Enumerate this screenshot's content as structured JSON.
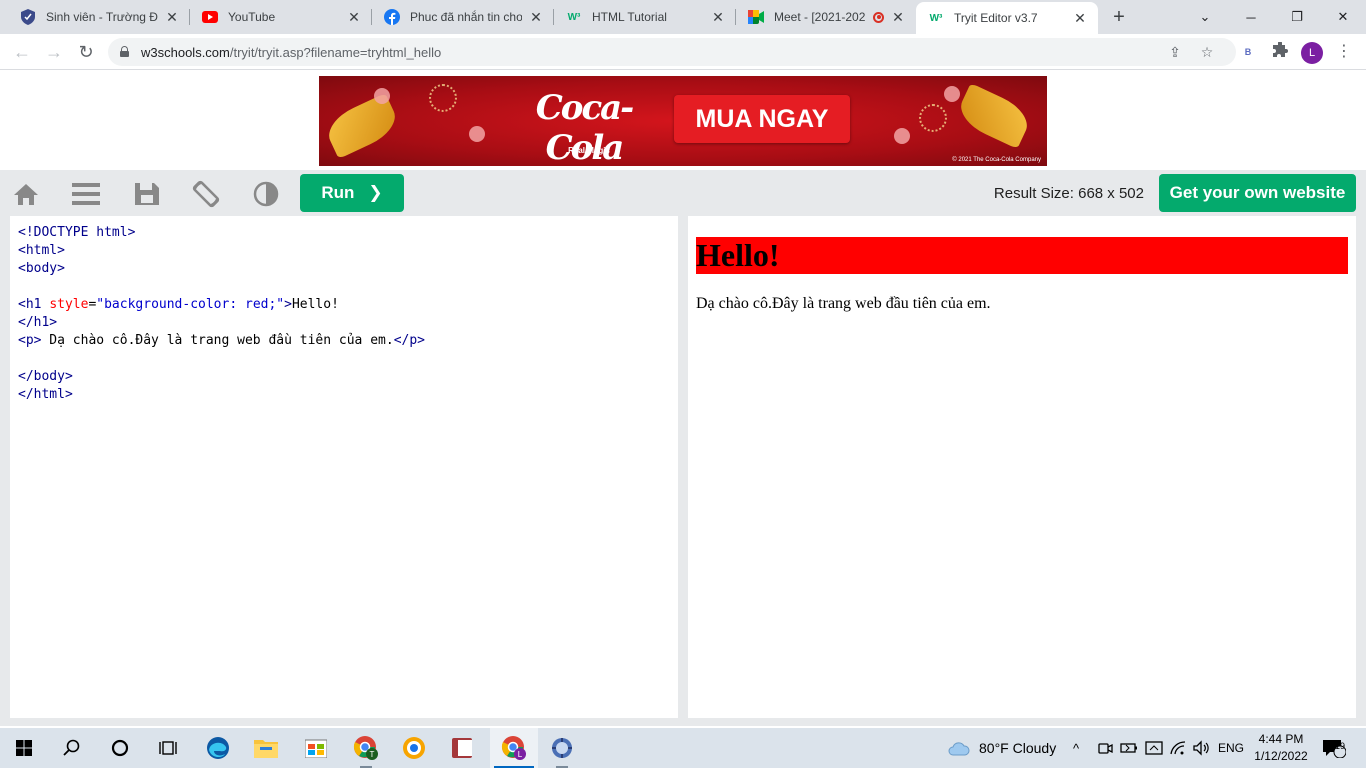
{
  "browser": {
    "tabs": [
      {
        "title": "Sinh viên - Trường Đại",
        "favicon": "shield-icon"
      },
      {
        "title": "YouTube",
        "favicon": "youtube-icon"
      },
      {
        "title": "Phuc đã nhắn tin cho",
        "favicon": "facebook-icon"
      },
      {
        "title": "HTML Tutorial",
        "favicon": "w3schools-icon"
      },
      {
        "title": "Meet - [2021-202",
        "favicon": "meet-icon",
        "recording": true
      },
      {
        "title": "Tryit Editor v3.7",
        "favicon": "w3schools-icon",
        "active": true
      }
    ],
    "url_host": "w3schools.com",
    "url_path": "/tryit/tryit.asp?filename=tryhtml_hello",
    "profile_initial": "L",
    "extension_label": "B"
  },
  "ad": {
    "brand": "Coca-Cola",
    "tagline": "Real Magic",
    "cta": "MUA NGAY",
    "copyright": "© 2021 The Coca-Cola Company"
  },
  "tryit": {
    "run_label": "Run",
    "result_size": "Result Size: 668 x 502",
    "own_website_label": "Get your own website",
    "icons": [
      "home-icon",
      "menu-icon",
      "save-icon",
      "rotate-icon",
      "contrast-icon"
    ]
  },
  "code": {
    "doctype": "<!DOCTYPE html>",
    "html_open": "<html>",
    "body_open": "<body>",
    "h1_open_tag": "<h1",
    "h1_attr": "style",
    "h1_eq": "=",
    "h1_value": "\"background-color: red;\"",
    "h1_gt": ">",
    "h1_text": "Hello!",
    "h1_close": "</h1>",
    "p_open": "<p>",
    "p_text": " Dạ chào cô.Đây là trang web đầu tiên của em.",
    "p_close": "</p>",
    "body_close": "</body>",
    "html_close": "</html>"
  },
  "result": {
    "heading": "Hello!",
    "paragraph": "Dạ chào cô.Đây là trang web đầu tiên của em."
  },
  "taskbar": {
    "weather": "80°F  Cloudy",
    "language": "ENG",
    "time": "4:44 PM",
    "date": "1/12/2022",
    "notifications": "19"
  }
}
